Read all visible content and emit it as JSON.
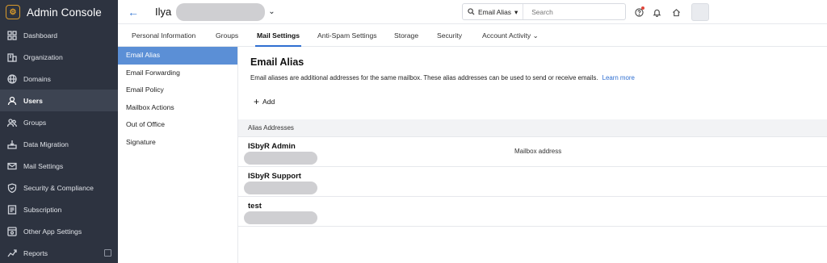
{
  "sidebar": {
    "brand": "Admin Console",
    "items": [
      {
        "label": "Dashboard",
        "icon": "dashboard-icon",
        "active": false
      },
      {
        "label": "Organization",
        "icon": "organization-icon",
        "active": false
      },
      {
        "label": "Domains",
        "icon": "globe-icon",
        "active": false
      },
      {
        "label": "Users",
        "icon": "user-icon",
        "active": true
      },
      {
        "label": "Groups",
        "icon": "groups-icon",
        "active": false
      },
      {
        "label": "Data Migration",
        "icon": "migration-icon",
        "active": false
      },
      {
        "label": "Mail Settings",
        "icon": "mail-settings-icon",
        "active": false
      },
      {
        "label": "Security & Compliance",
        "icon": "shield-icon",
        "active": false
      },
      {
        "label": "Subscription",
        "icon": "subscription-icon",
        "active": false
      },
      {
        "label": "Other App Settings",
        "icon": "apps-icon",
        "active": false
      },
      {
        "label": "Reports",
        "icon": "reports-icon",
        "active": false
      }
    ]
  },
  "header": {
    "user_name": "Ilya",
    "search_scope": "Email Alias",
    "search_placeholder": "Search"
  },
  "tabs": [
    "Personal Information",
    "Groups",
    "Mail Settings",
    "Anti-Spam Settings",
    "Storage",
    "Security",
    "Account Activity"
  ],
  "active_tab": "Mail Settings",
  "subnav": [
    "Email Alias",
    "Email Forwarding",
    "Email Policy",
    "Mailbox Actions",
    "Out of Office",
    "Signature"
  ],
  "main": {
    "title": "Email Alias",
    "description": "Email aliases are additional addresses for the same mailbox. These alias addresses can be used to send or receive emails.",
    "learn_more": "Learn more",
    "add_label": "Add",
    "table_header": "Alias Addresses",
    "aliases": [
      {
        "name": "ISbyR Admin",
        "note": "Mailbox address"
      },
      {
        "name": "ISbyR Support",
        "note": ""
      },
      {
        "name": "test",
        "note": ""
      }
    ]
  },
  "colors": {
    "sidebar_bg": "#2d3340",
    "accent": "#2f6fd1",
    "subnav_active": "#5b8fd6",
    "notification_dot": "#e0463a"
  }
}
